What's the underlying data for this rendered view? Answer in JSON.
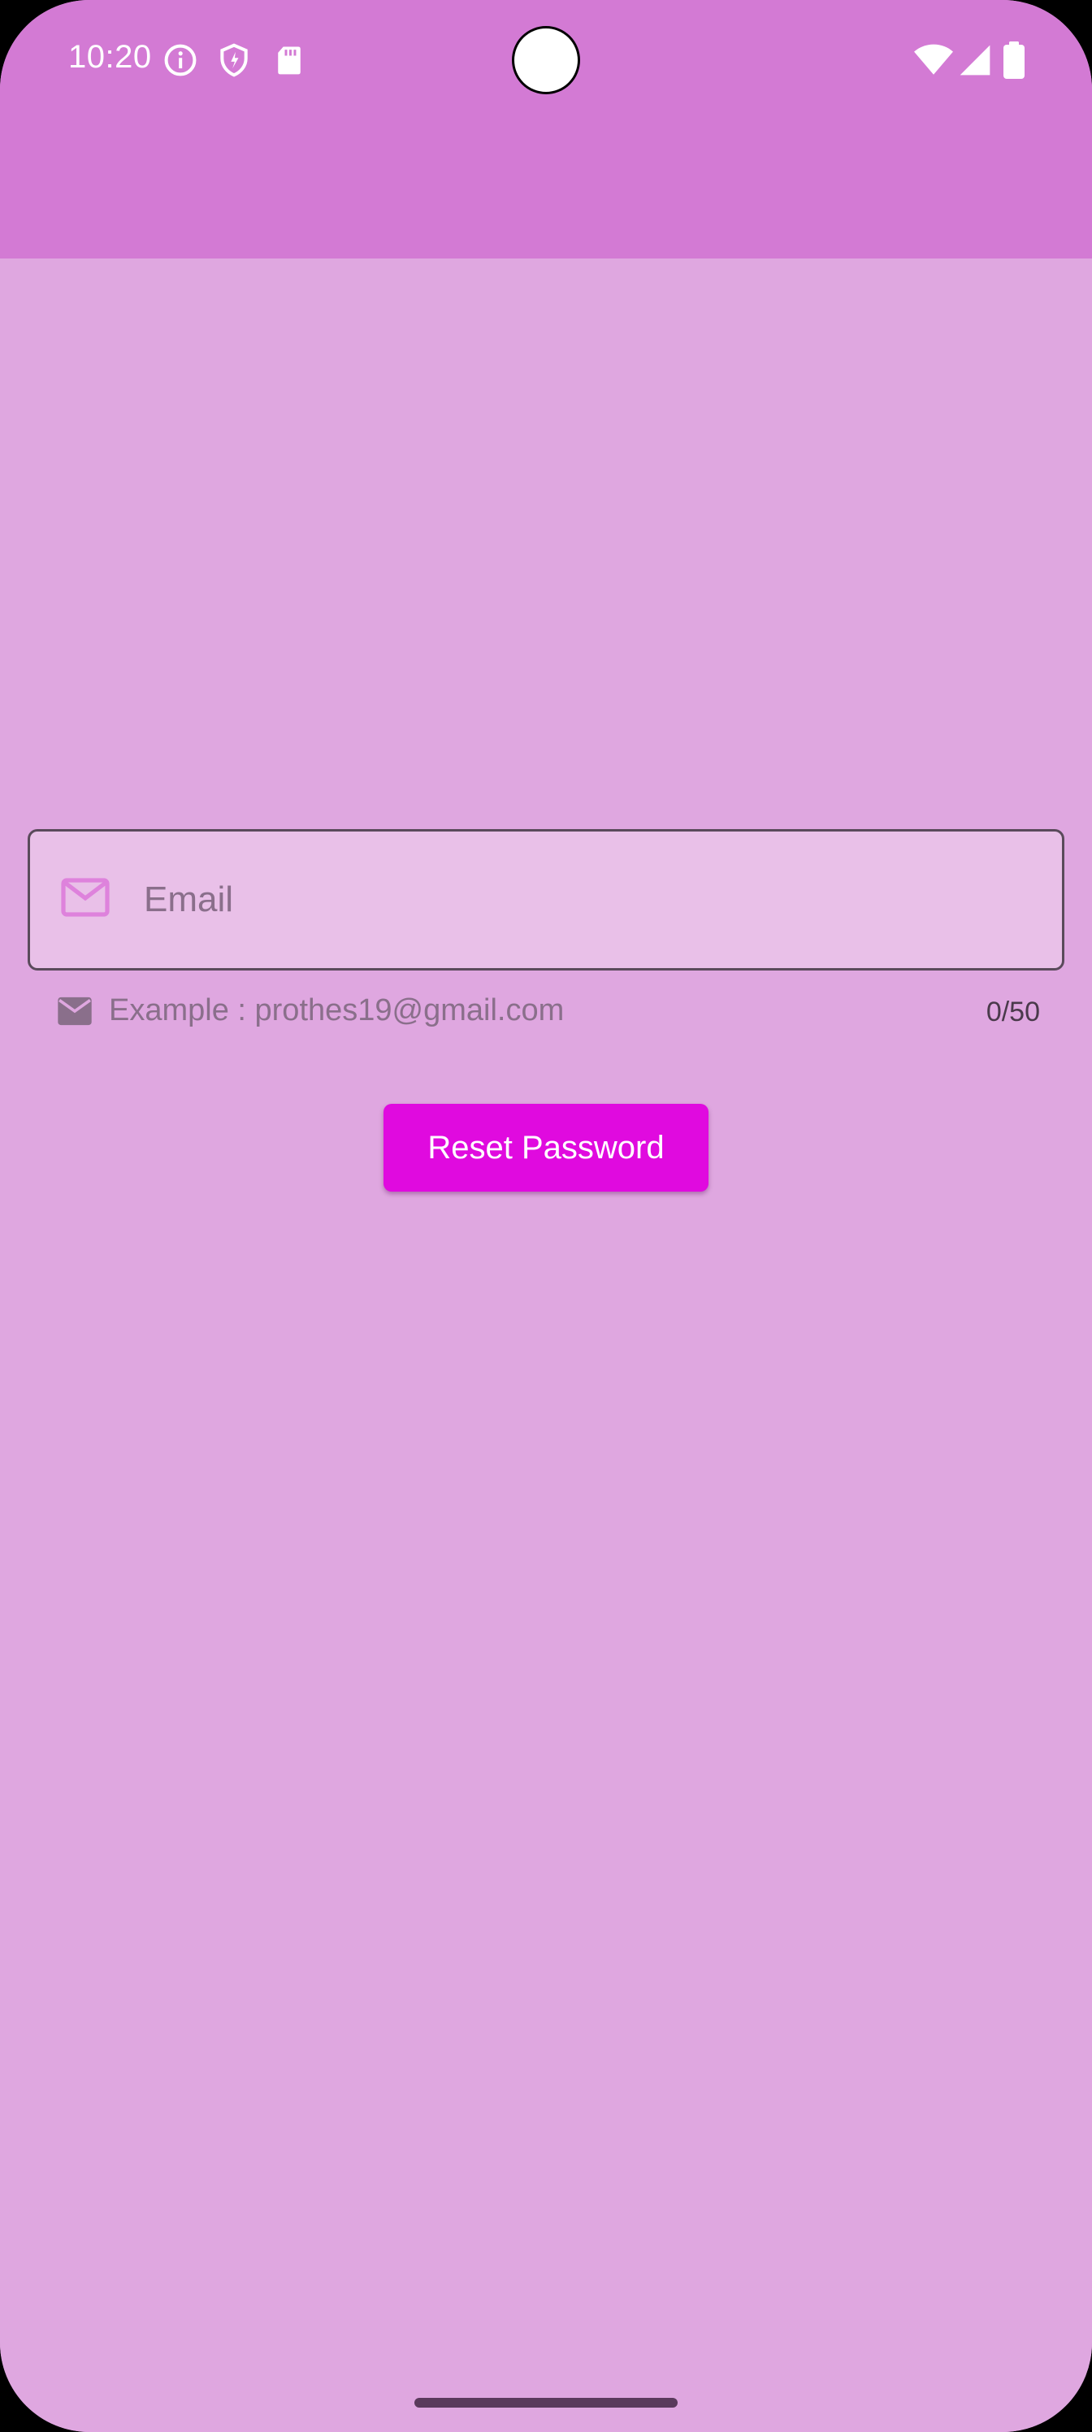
{
  "status_bar": {
    "time": "10:20",
    "left_icons": [
      "info-icon",
      "shield-icon",
      "sd-card-icon"
    ],
    "right_icons": [
      "wifi-icon",
      "signal-icon",
      "battery-icon"
    ]
  },
  "form": {
    "email_placeholder": "Email",
    "email_value": "",
    "helper_text": "Example : prothes19@gmail.com",
    "counter": "0/50",
    "submit_label": "Reset Password"
  },
  "colors": {
    "app_bar": "#D37AD4",
    "background": "#DFA7E0",
    "field_fill": "#E9C0E8",
    "button": "#E00ADF"
  }
}
